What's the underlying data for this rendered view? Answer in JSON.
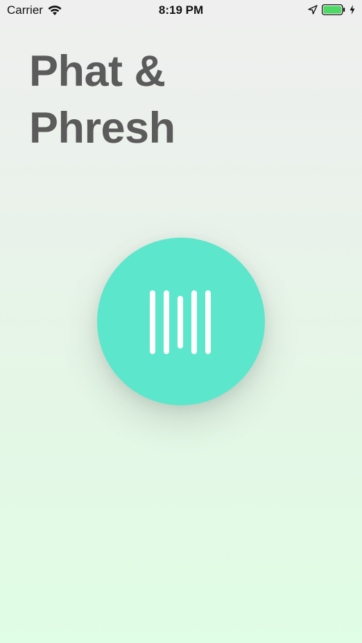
{
  "status_bar": {
    "carrier": "Carrier",
    "time": "8:19 PM",
    "battery_color": "#4cd964"
  },
  "app": {
    "title_line1": "Phat &",
    "title_line2": "Phresh",
    "accent_color": "#5ce6cc",
    "title_color": "#5b5b5b",
    "record_button_icon": "waveform-icon"
  }
}
